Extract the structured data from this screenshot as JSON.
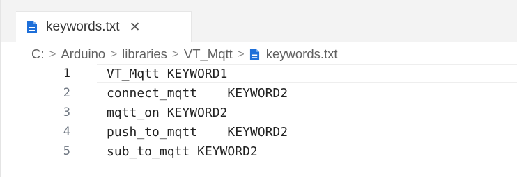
{
  "tab": {
    "label": "keywords.txt",
    "close_glyph": "✕",
    "icon": "file-text-icon"
  },
  "breadcrumb": {
    "items": [
      "C:",
      "Arduino",
      "libraries",
      "VT_Mqtt",
      "keywords.txt"
    ],
    "separator": ">"
  },
  "editor": {
    "lines": [
      {
        "number": "1",
        "text": "VT_Mqtt KEYWORD1"
      },
      {
        "number": "2",
        "text": "connect_mqtt\tKEYWORD2"
      },
      {
        "number": "3",
        "text": "mqtt_on KEYWORD2"
      },
      {
        "number": "4",
        "text": "push_to_mqtt\tKEYWORD2"
      },
      {
        "number": "5",
        "text": "sub_to_mqtt KEYWORD2"
      }
    ],
    "active_line": 1
  },
  "colors": {
    "file_icon": "#1e6fd9",
    "tab_bar_bg": "#f3f3f3"
  }
}
